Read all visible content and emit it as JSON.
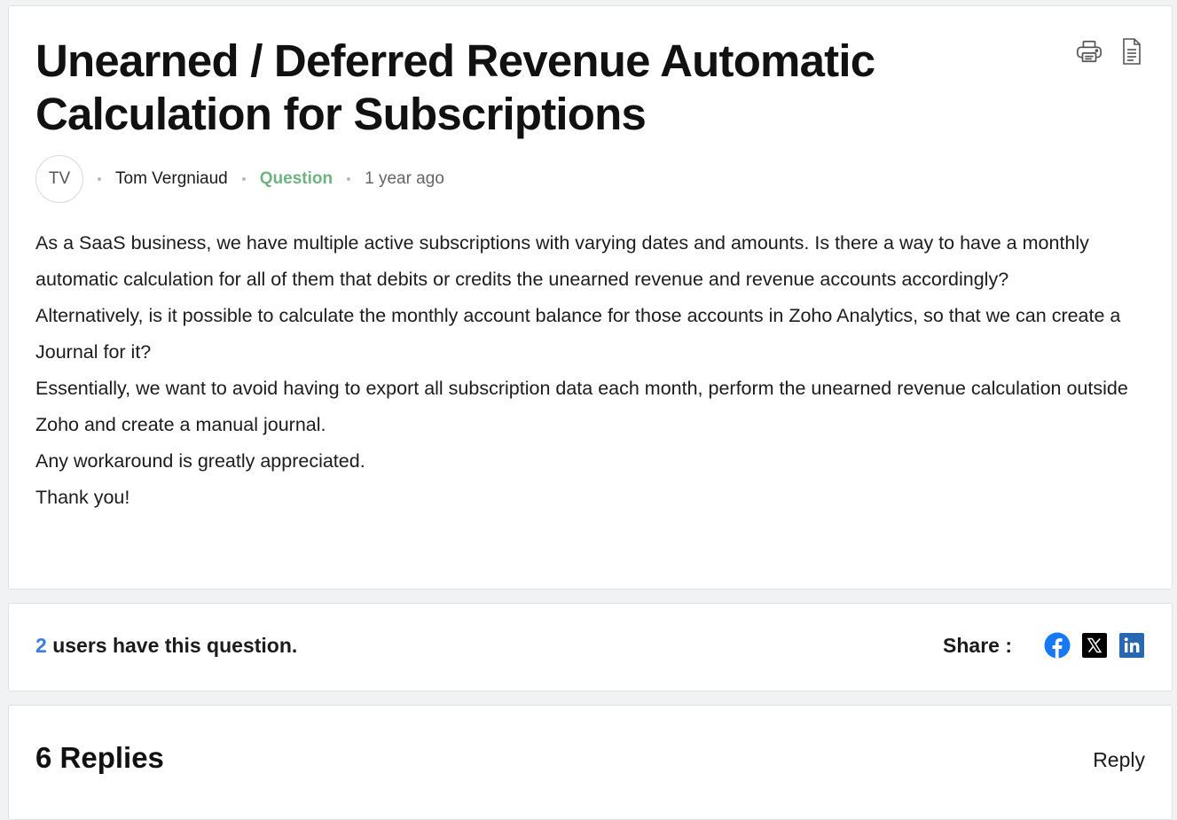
{
  "post": {
    "title": "Unearned / Deferred Revenue Automatic Calculation for Subscriptions",
    "author_initials": "TV",
    "author_name": "Tom Vergniaud",
    "post_type": "Question",
    "post_type_color": "#6fb381",
    "time_ago": "1 year ago",
    "icons": {
      "print": "print-icon",
      "document": "document-icon"
    },
    "body": [
      "As a SaaS business, we have multiple active subscriptions with varying dates and amounts. Is there a way to have a monthly automatic calculation for all of them that debits or credits the unearned revenue and revenue accounts accordingly?",
      "Alternatively, is it possible to calculate the monthly account balance for those accounts in Zoho Analytics, so that we can create a Journal for it?",
      "Essentially, we want to avoid having to export all subscription data each month, perform the unearned revenue calculation outside Zoho and create a manual journal.",
      "Any workaround is greatly appreciated.",
      "Thank you!"
    ]
  },
  "meta": {
    "users_count": "2",
    "users_text": "users have this question.",
    "count_color": "#3e7ce0",
    "share_label": "Share :",
    "social_icons": [
      "facebook-icon",
      "x-icon",
      "linkedin-icon"
    ]
  },
  "replies": {
    "count_label": "6 Replies",
    "reply_label": "Reply"
  }
}
